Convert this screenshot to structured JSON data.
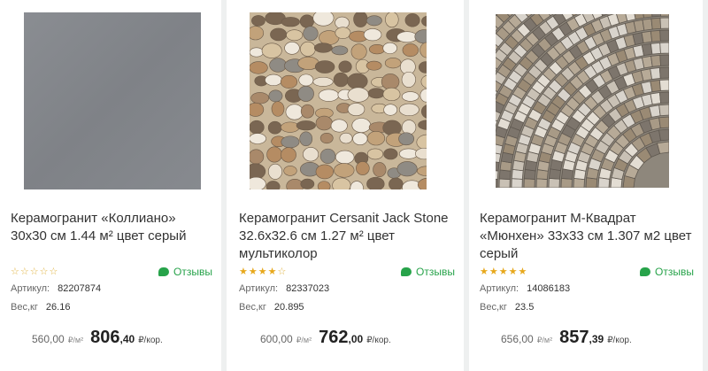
{
  "products": [
    {
      "title": "Керамогранит «Коллиано» 30x30 см 1.44 м² цвет серый",
      "rating_stars": 0,
      "reviews_label": "Отзывы",
      "article_label": "Артикул:",
      "article": "82207874",
      "weight_label": "Вес,кг",
      "weight": "26.16",
      "price_per_m2": "560,00",
      "price_per_m2_unit": "₽/м²",
      "price_per_pack_whole": "806",
      "price_per_pack_cents": ",40",
      "price_per_pack_unit": "₽/кор.",
      "image": "gray-tile"
    },
    {
      "title": "Керамогранит Cersanit Jack Stone 32.6x32.6 см 1.27 м² цвет мультиколор",
      "rating_stars": 4,
      "reviews_label": "Отзывы",
      "article_label": "Артикул:",
      "article": "82337023",
      "weight_label": "Вес,кг",
      "weight": "20.895",
      "price_per_m2": "600,00",
      "price_per_m2_unit": "₽/м²",
      "price_per_pack_whole": "762",
      "price_per_pack_cents": ",00",
      "price_per_pack_unit": "₽/кор.",
      "image": "pebble-mosaic-tile"
    },
    {
      "title": "Керамогранит М-Квадрат «Мюнхен» 33х33 см 1.307 м2 цвет серый",
      "rating_stars": 5,
      "reviews_label": "Отзывы",
      "article_label": "Артикул:",
      "article": "14086183",
      "weight_label": "Вес,кг",
      "weight": "23.5",
      "price_per_m2": "656,00",
      "price_per_m2_unit": "₽/м²",
      "price_per_pack_whole": "857",
      "price_per_pack_cents": ",39",
      "price_per_pack_unit": "₽/кор.",
      "image": "stone-arc-mosaic-tile"
    }
  ],
  "colors": {
    "accent_green": "#27a34a",
    "star": "#e7a81c",
    "background": "#eef0f0"
  }
}
